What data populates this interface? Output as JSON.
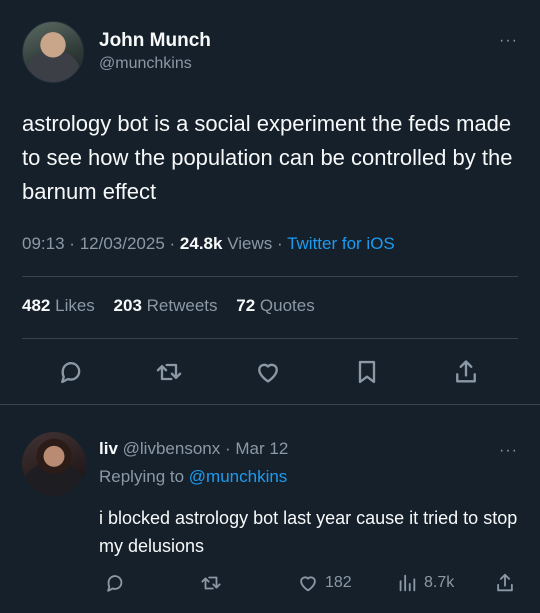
{
  "tweet": {
    "author_name": "John Munch",
    "author_handle": "@munchkins",
    "more": "···",
    "text": "astrology bot is a social experiment the feds made to see how the population can be controlled by the barnum effect",
    "time": "09:13",
    "date": "12/03/2025",
    "views_count": "24.8k",
    "views_label": "Views",
    "source": "Twitter for iOS",
    "sep": "·",
    "likes_count": "482",
    "likes_label": "Likes",
    "retweets_count": "203",
    "retweets_label": "Retweets",
    "quotes_count": "72",
    "quotes_label": "Quotes"
  },
  "reply": {
    "author_name": "liv",
    "author_handle": "@livbensonx",
    "sep": "·",
    "date": "Mar 12",
    "more": "···",
    "replying_prefix": "Replying to",
    "replying_to": "@munchkins",
    "text": "i blocked astrology bot last year cause it tried to stop my delusions",
    "likes": "182",
    "views": "8.7k"
  },
  "icons": [
    "reply-icon",
    "retweet-icon",
    "like-icon",
    "bookmark-icon",
    "share-icon",
    "views-icon"
  ]
}
